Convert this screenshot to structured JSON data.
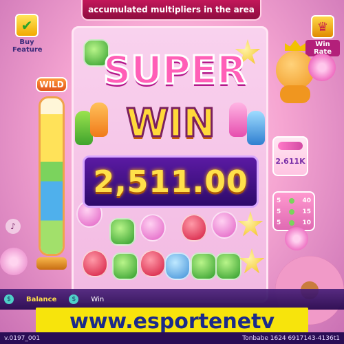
{
  "game": {
    "banner_text": "accumulated multipliers in the area",
    "left_icon_label": "Buy Feature",
    "right_icon_label": "Win Rate",
    "wild_label": "WILD",
    "wild_meter_level": 0.9,
    "super_text": "SUPER",
    "win_text": "WIN",
    "win_amount": "2,511.00",
    "multiplier_value": "2.611K",
    "pay_rows": [
      {
        "count": "5",
        "value": "40"
      },
      {
        "count": "5",
        "value": "15"
      },
      {
        "count": "5",
        "value": "10"
      }
    ]
  },
  "info_bar": {
    "balance_label": "Balance",
    "win_label": "Win"
  },
  "version": {
    "left": "v.0197_001",
    "right": "Tonbabe 1624 6917143-4136t1"
  },
  "watermark": {
    "text": "www.esportenetv"
  },
  "colors": {
    "banner": "#c2175a",
    "amount_text": "#ffe04a",
    "watermark_bg": "#f7e40c",
    "watermark_text": "#1b2a8a"
  }
}
